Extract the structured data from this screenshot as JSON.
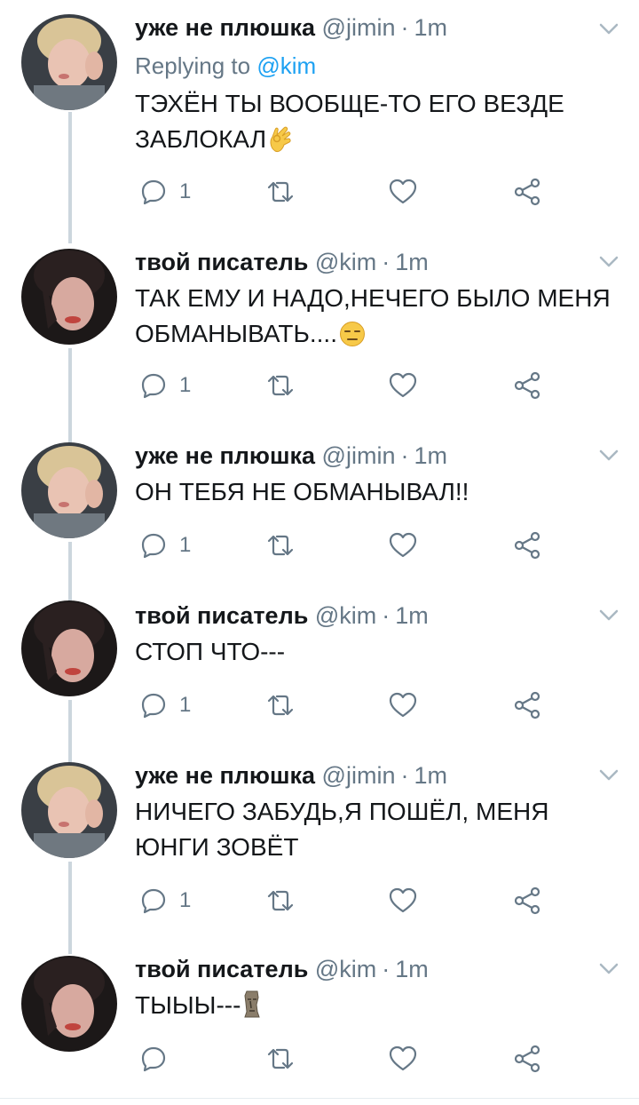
{
  "tweets": [
    {
      "name": "уже не плюшка",
      "handle": "@jimin",
      "time": "1m",
      "replying_prefix": "Replying to ",
      "replying_to": "@kim",
      "text": "ТЭХЁН ТЫ ВООБЩЕ-ТО ЕГО ВЕЗДЕ\nЗАБЛОКАЛ",
      "emoji": "ok-hand",
      "reply_count": "1"
    },
    {
      "name": "твой писатель",
      "handle": "@kim",
      "time": "1m",
      "text": "ТАК ЕМУ И НАДО,НЕЧЕГО БЫЛО МЕНЯ\nОБМАНЫВАТЬ....",
      "emoji": "expressionless-face",
      "reply_count": "1"
    },
    {
      "name": "уже не плюшка",
      "handle": "@jimin",
      "time": "1m",
      "text": "ОН ТЕБЯ НЕ ОБМАНЫВАЛ!!",
      "reply_count": "1"
    },
    {
      "name": "твой писатель",
      "handle": "@kim",
      "time": "1m",
      "text": "СТОП ЧТО---",
      "reply_count": "1"
    },
    {
      "name": "уже не плюшка",
      "handle": "@jimin",
      "time": "1m",
      "text": "НИЧЕГО ЗАБУДЬ,Я ПОШЁЛ, МЕНЯ\nЮНГИ ЗОВЁТ",
      "reply_count": "1"
    },
    {
      "name": "твой писатель",
      "handle": "@kim",
      "time": "1m",
      "text": "ТЫЫЫ---",
      "emoji": "moai",
      "reply_count": ""
    }
  ],
  "dot": "·",
  "icons": {
    "reply": "reply-icon",
    "retweet": "retweet-icon",
    "like": "heart-icon",
    "share": "share-icon",
    "menu": "chevron-down-icon"
  },
  "colors": {
    "name": "#14171a",
    "meta": "#657786",
    "mention": "#1da1f2",
    "thread_line": "#ccd6dd",
    "icon": "#657786"
  }
}
